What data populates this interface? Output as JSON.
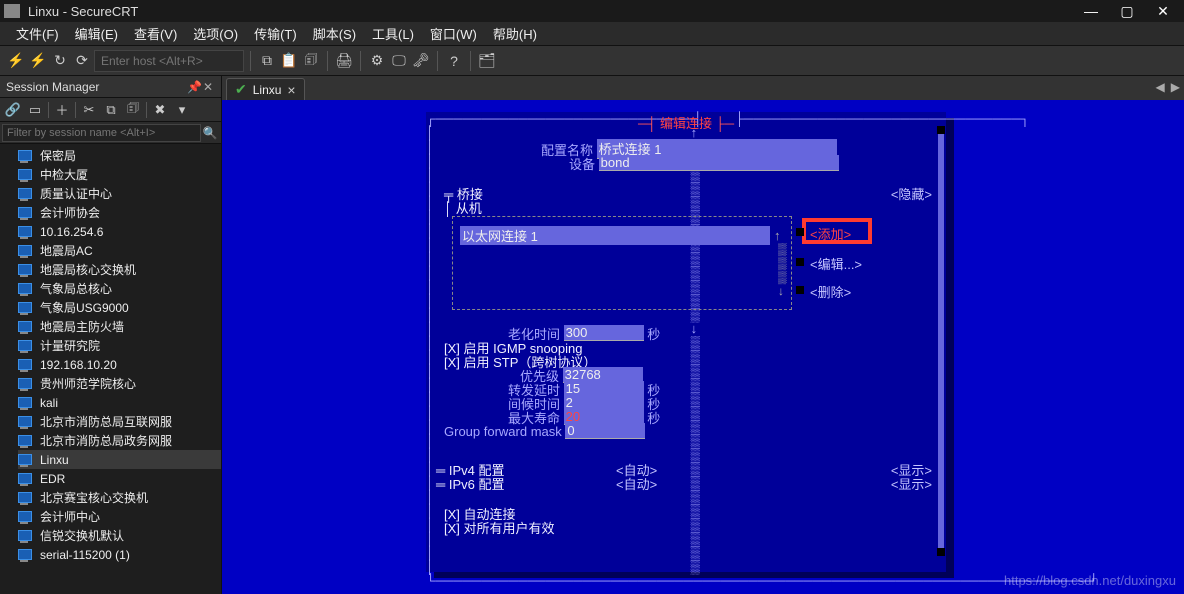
{
  "window_title": "Linxu - SecureCRT",
  "menu": {
    "file": "文件(F)",
    "edit": "编辑(E)",
    "view": "查看(V)",
    "options": "选项(O)",
    "transfer": "传输(T)",
    "script": "脚本(S)",
    "tools": "工具(L)",
    "window": "窗口(W)",
    "help": "帮助(H)"
  },
  "toolbar": {
    "host_placeholder": "Enter host <Alt+R>"
  },
  "session_manager": {
    "title": "Session Manager",
    "filter_placeholder": "Filter by session name <Alt+I>",
    "sessions": [
      "保密局",
      "中检大厦",
      "质量认证中心",
      "会计师协会",
      "10.16.254.6",
      "地震局AC",
      "地震局核心交换机",
      "气象局总核心",
      "气象局USG9000",
      "地震局主防火墙",
      "计量研究院",
      "192.168.10.20",
      "贵州师范学院核心",
      "kali",
      "北京市消防总局互联网服",
      "北京市消防总局政务网服",
      "Linxu",
      "EDR",
      "北京赛宝核心交换机",
      "会计师中心",
      "信锐交换机默认",
      "serial-115200 (1)"
    ],
    "active_session": "Linxu"
  },
  "tab_name": "Linxu",
  "tui": {
    "title": "编辑连接",
    "profile_name_label": "配置名称",
    "profile_name_value": "桥式连接 1",
    "device_label": "设备",
    "device_value": "bond",
    "bridge_label": "桥接",
    "slaves_label": "从机",
    "slave_entry": "以太网连接 1",
    "hide_btn": "<隐藏>",
    "add_btn": "<添加>",
    "edit_btn": "<编辑...>",
    "delete_btn": "<删除>",
    "aging_label": "老化时间",
    "aging_value": "300",
    "seconds": "秒",
    "igmp": "[X] 启用 IGMP snooping",
    "stp": "[X] 启用 STP（跨树协议）",
    "priority_label": "优先级",
    "priority_value": "32768",
    "fwd_delay_label": "转发延时",
    "fwd_delay_value": "15",
    "hello_label": "间候时间",
    "hello_value": "2",
    "max_age_label": "最大寿命",
    "max_age_value": "20",
    "gfm_label": "Group forward mask",
    "gfm_value": "0",
    "ipv4_label": "IPv4 配置",
    "ipv6_label": "IPv6 配置",
    "auto": "<自动>",
    "show": "<显示>",
    "auto_connect": "[X] 自动连接",
    "all_users": "[X] 对所有用户有效"
  },
  "watermark": "https://blog.csdn.net/duxingxu"
}
